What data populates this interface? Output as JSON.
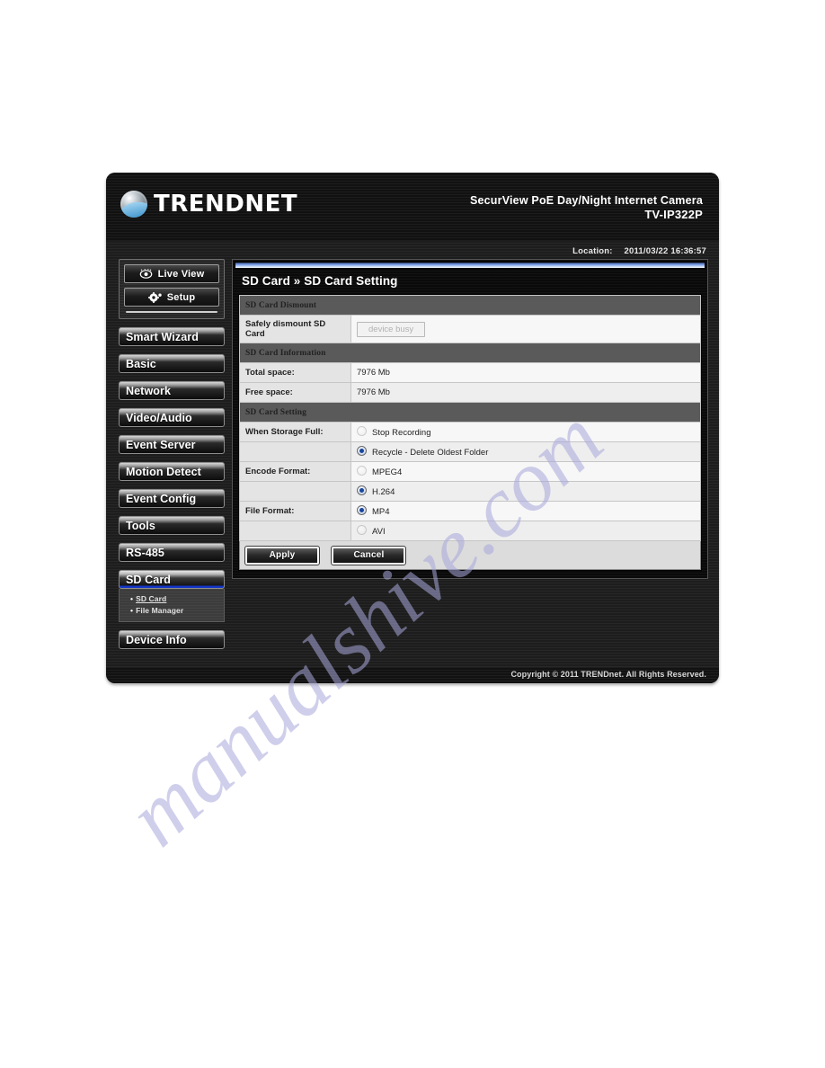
{
  "header": {
    "brand": "TRENDNET",
    "product_line": "SecurView PoE Day/Night Internet Camera",
    "model": "TV-IP322P",
    "location_label": "Location:",
    "location_value": "2011/03/22 16:36:57"
  },
  "sidebar": {
    "view_buttons": [
      {
        "label": "Live View",
        "icon": "eye-icon"
      },
      {
        "label": "Setup",
        "icon": "gear-icon"
      }
    ],
    "items": [
      {
        "label": "Smart Wizard",
        "active": false
      },
      {
        "label": "Basic",
        "active": false
      },
      {
        "label": "Network",
        "active": false
      },
      {
        "label": "Video/Audio",
        "active": false
      },
      {
        "label": "Event Server",
        "active": false
      },
      {
        "label": "Motion Detect",
        "active": false
      },
      {
        "label": "Event Config",
        "active": false
      },
      {
        "label": "Tools",
        "active": false
      },
      {
        "label": "RS-485",
        "active": false
      },
      {
        "label": "SD Card",
        "active": true
      },
      {
        "label": "Device Info",
        "active": false
      }
    ],
    "submenu": [
      {
        "label": "SD Card",
        "current": true
      },
      {
        "label": "File Manager",
        "current": false
      }
    ]
  },
  "panel": {
    "title": "SD Card » SD Card Setting",
    "sections": {
      "dismount": {
        "heading": "SD Card Dismount",
        "row_label": "Safely dismount SD Card",
        "button_label": "device busy"
      },
      "information": {
        "heading": "SD Card Information",
        "rows": [
          {
            "label": "Total space:",
            "value": "7976 Mb"
          },
          {
            "label": "Free space:",
            "value": "7976 Mb"
          }
        ]
      },
      "setting": {
        "heading": "SD Card Setting",
        "groups": [
          {
            "label": "When Storage Full:",
            "options": [
              {
                "label": "Stop Recording",
                "selected": false
              },
              {
                "label": "Recycle - Delete Oldest Folder",
                "selected": true
              }
            ]
          },
          {
            "label": "Encode Format:",
            "options": [
              {
                "label": "MPEG4",
                "selected": false
              },
              {
                "label": "H.264",
                "selected": true
              }
            ]
          },
          {
            "label": "File Format:",
            "options": [
              {
                "label": "MP4",
                "selected": true
              },
              {
                "label": "AVI",
                "selected": false
              }
            ]
          }
        ]
      }
    },
    "buttons": {
      "apply": "Apply",
      "cancel": "Cancel"
    }
  },
  "footer": {
    "copyright": "Copyright © 2011 TRENDnet. All Rights Reserved."
  },
  "watermark": {
    "text": "manualshive.com"
  },
  "colors": {
    "accent_blue": "#1436c8",
    "panel_header_gray": "#5a5a5a",
    "frame_black": "#1d1d1d",
    "radio_dot": "#18459e"
  }
}
